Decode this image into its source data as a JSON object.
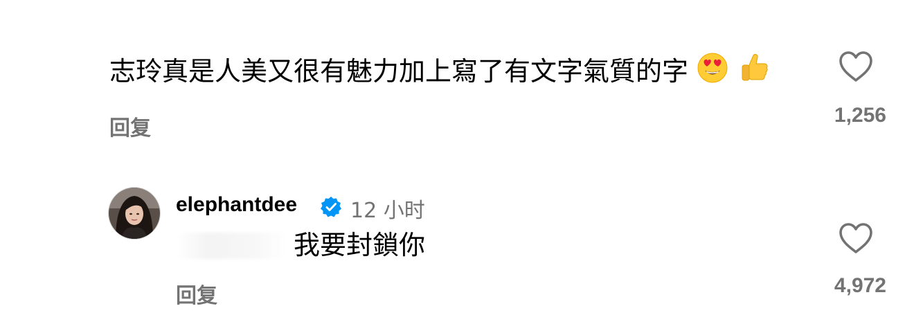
{
  "comment_1": {
    "text": "志玲真是人美又很有魅力加上寫了有文字氣質的字",
    "emojis": [
      "heart-eyes-emoji",
      "thumbs-up-emoji"
    ],
    "reply_label": "回复",
    "like_count": "1,256"
  },
  "comment_2": {
    "username": "elephantdee",
    "verified": true,
    "timestamp": "12 小时",
    "text": "我要封鎖你",
    "reply_label": "回复",
    "like_count": "4,972"
  },
  "colors": {
    "secondary_text": "#737373",
    "verified_blue": "#0095f6",
    "text": "#000000"
  }
}
